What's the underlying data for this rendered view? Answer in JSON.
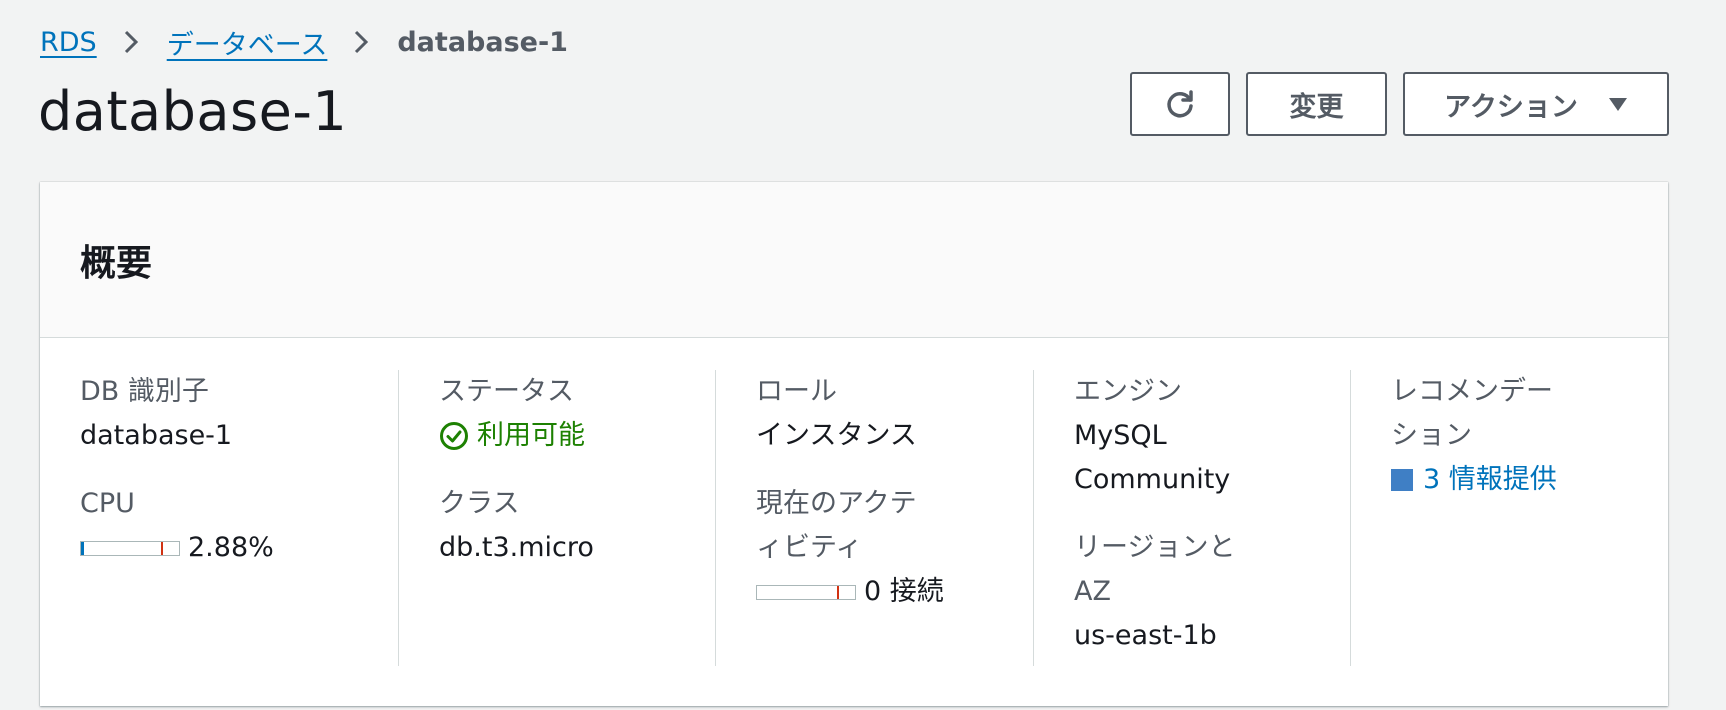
{
  "breadcrumb": {
    "items": [
      {
        "label": "RDS"
      },
      {
        "label": "データベース"
      }
    ],
    "current": "database-1"
  },
  "page": {
    "title": "database-1"
  },
  "toolbar": {
    "refresh_icon": "refresh-icon",
    "modify_label": "変更",
    "actions_label": "アクション",
    "actions_icon": "caret-down-icon"
  },
  "summary": {
    "heading": "概要",
    "db_identifier": {
      "label": "DB 識別子",
      "value": "database-1"
    },
    "cpu": {
      "label": "CPU",
      "value": "2.88%",
      "fraction": 0.0288
    },
    "status": {
      "label": "ステータス",
      "value": "利用可能",
      "icon": "check-circle-icon",
      "color": "#1d8102"
    },
    "class": {
      "label": "クラス",
      "value": "db.t3.micro"
    },
    "role": {
      "label": "ロール",
      "value": "インスタンス"
    },
    "activity": {
      "label_line1": "現在のアクテ",
      "label_line2": "ィビティ",
      "value": "0 接続",
      "fraction": 0
    },
    "engine": {
      "label": "エンジン",
      "value_line1": "MySQL",
      "value_line2": "Community"
    },
    "region": {
      "label_line1": "リージョンと",
      "label_line2": "AZ",
      "value": "us-east-1b"
    },
    "recommendation": {
      "label_line1": "レコメンデー",
      "label_line2": "ション",
      "value": "3 情報提供",
      "color": "#0073bb"
    }
  },
  "colors": {
    "link": "#0073bb",
    "meter_fill": "#0073bb",
    "meter_threshold": "#d13212",
    "status_ok": "#1d8102"
  }
}
